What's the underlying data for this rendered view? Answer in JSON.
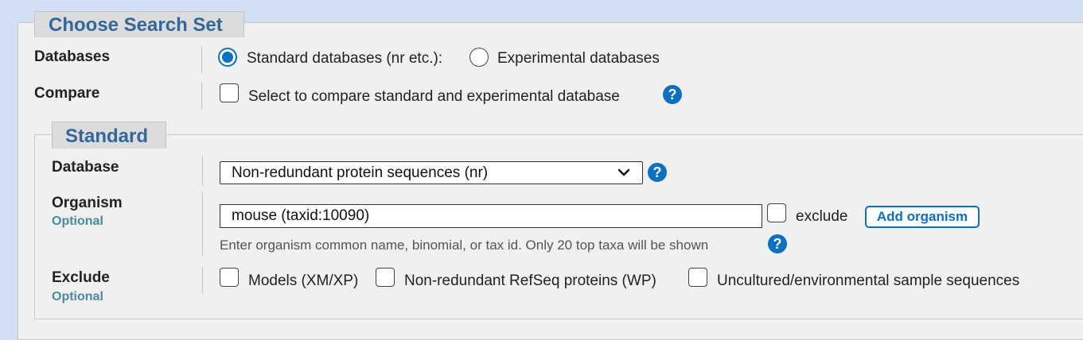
{
  "search_set": {
    "legend": "Choose Search Set",
    "databases_label": "Databases",
    "databases_options": [
      "Standard databases (nr etc.):",
      "Experimental databases"
    ],
    "compare_label": "Compare",
    "compare_text": "Select to compare standard and experimental database"
  },
  "standard": {
    "legend": "Standard",
    "database_label": "Database",
    "database_value": "Non-redundant protein sequences (nr)",
    "organism_label": "Organism",
    "organism_optional": "Optional",
    "organism_value": "mouse (taxid:10090)",
    "exclude_checkbox_label": "exclude",
    "add_organism_label": "Add organism",
    "organism_hint": "Enter organism common name, binomial, or tax id. Only 20 top taxa will be shown",
    "exclude_label": "Exclude",
    "exclude_optional": "Optional",
    "exclude_options": [
      "Models (XM/XP)",
      "Non-redundant RefSeq proteins (WP)",
      "Uncultured/environmental sample sequences"
    ]
  },
  "icons": {
    "help": "?"
  },
  "colors": {
    "accent": "#0b6fc2",
    "legend_text": "#336699",
    "optional_text": "#4a8aa0",
    "page_bg": "#d3dff5",
    "panel_bg": "#f0f0f0"
  }
}
